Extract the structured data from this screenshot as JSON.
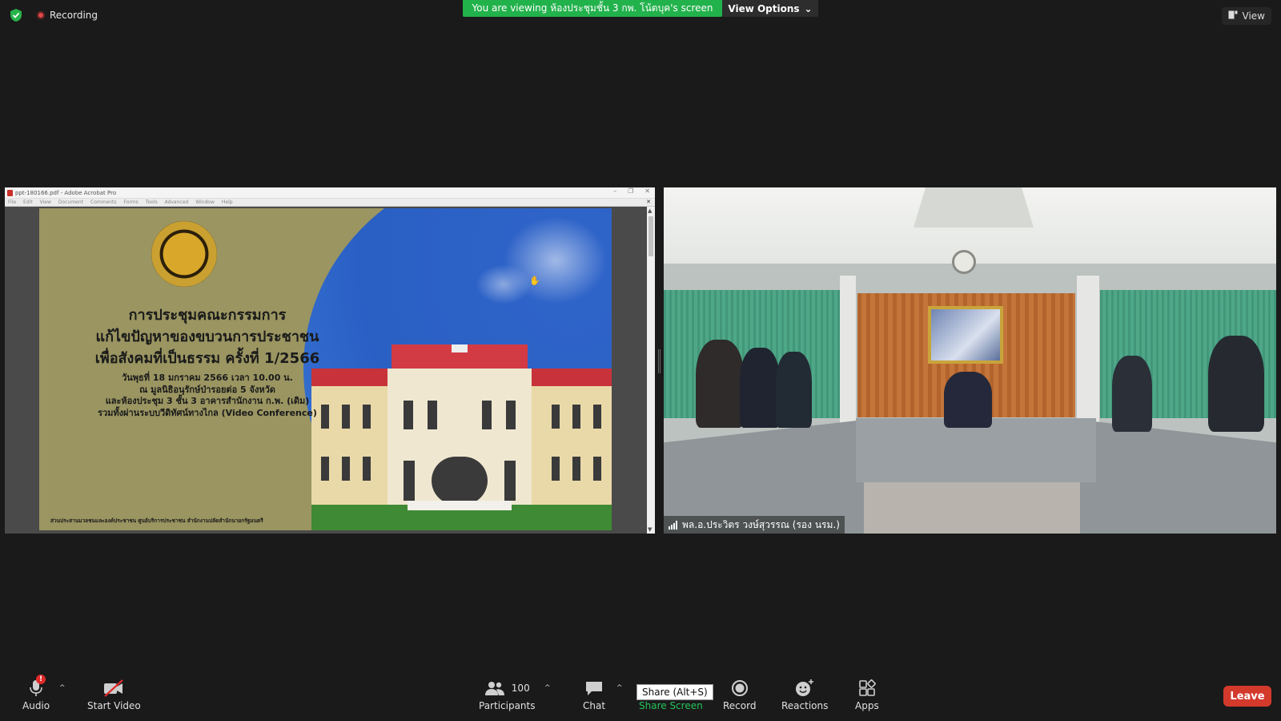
{
  "top": {
    "recording_label": "Recording",
    "viewing_banner": "You are viewing ห้องประชุมชั้น 3 กพ. โน้ตบุค's screen",
    "view_options_label": "View Options",
    "view_label": "View"
  },
  "share": {
    "window_title": "ppt-180166.pdf - Adobe Acrobat Pro",
    "menu": [
      "File",
      "Edit",
      "View",
      "Document",
      "Comments",
      "Forms",
      "Tools",
      "Advanced",
      "Window",
      "Help"
    ],
    "slide": {
      "title_lines": [
        "การประชุมคณะกรรมการ",
        "แก้ไขปัญหาของขบวนการประชาชน",
        "เพื่อสังคมที่เป็นธรรม ครั้งที่ 1/2566"
      ],
      "sub_lines": [
        "วันพุธที่ 18 มกราคม 2566 เวลา 10.00 น.",
        "ณ มูลนิธิอนุรักษ์ป่ารอยต่อ 5 จังหวัด",
        "และห้องประชุม 3 ชั้น 3  อาคารสำนักงาน ก.พ. (เดิม)",
        "รวมทั้งผ่านระบบวีดิทัศน์ทางไกล (Video Conference)"
      ],
      "footer": "ส่วนประสานมวลชนและองค์ประชาชน ศูนย์บริการประชาชน สำนักงานปลัดสำนักนายกรัฐมนตรี"
    }
  },
  "video": {
    "participant_name": "พล.อ.ประวิตร วงษ์สุวรรณ (รอง นรม.)"
  },
  "toolbar": {
    "audio_label": "Audio",
    "audio_badge": "!",
    "video_label": "Start Video",
    "participants_label": "Participants",
    "participants_count": "100",
    "chat_label": "Chat",
    "share_label": "Share Screen",
    "share_tooltip": "Share (Alt+S)",
    "record_label": "Record",
    "reactions_label": "Reactions",
    "apps_label": "Apps",
    "leave_label": "Leave"
  },
  "colors": {
    "banner_green": "#22b24c",
    "leave_red": "#d33a2c",
    "share_green": "#25c45a"
  }
}
